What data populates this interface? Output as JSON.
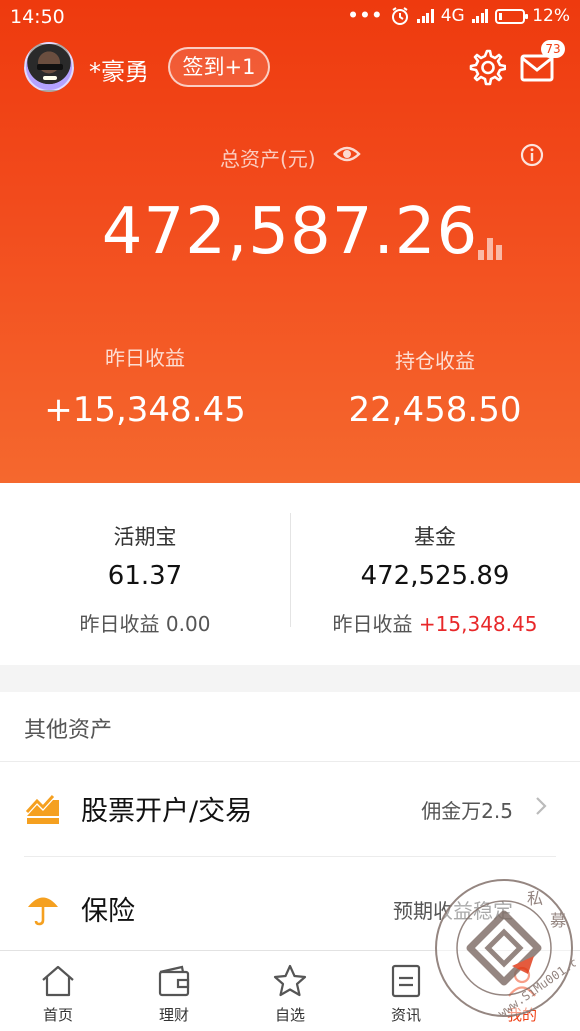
{
  "status_bar": {
    "time": "14:50",
    "network": "4G",
    "battery": "12%"
  },
  "header": {
    "username": "*豪勇",
    "checkin_label": "签到+1",
    "mail_badge": "73",
    "total_assets_label": "总资产(元)",
    "total_assets_value": "472,587.26",
    "yesterday_income_label": "昨日收益",
    "yesterday_income_value": "+15,348.45",
    "holding_income_label": "持仓收益",
    "holding_income_value": "22,458.50"
  },
  "cards": [
    {
      "title": "活期宝",
      "value": "61.37",
      "sub_label": "昨日收益",
      "sub_value": "0.00"
    },
    {
      "title": "基金",
      "value": "472,525.89",
      "sub_label": "昨日收益",
      "sub_value": "+15,348.45"
    }
  ],
  "other_assets": {
    "title": "其他资产",
    "items": [
      {
        "label": "股票开户/交易",
        "value": "佣金万2.5",
        "icon": "chart-trend-icon"
      },
      {
        "label": "保险",
        "value": "预期收益稳定",
        "icon": "umbrella-icon"
      }
    ]
  },
  "tabs": [
    {
      "label": "首页",
      "icon": "home-icon"
    },
    {
      "label": "理财",
      "icon": "wallet-icon"
    },
    {
      "label": "自选",
      "icon": "star-icon"
    },
    {
      "label": "资讯",
      "icon": "news-icon"
    },
    {
      "label": "我的",
      "icon": "user-icon"
    }
  ],
  "watermark": {
    "text": "私募  www.SiMu001.cn"
  },
  "colors": {
    "header_top": "#ee3a0e",
    "header_bottom": "#f5682e",
    "accent_red": "#e8282a",
    "icon_orange": "#f5a020"
  }
}
